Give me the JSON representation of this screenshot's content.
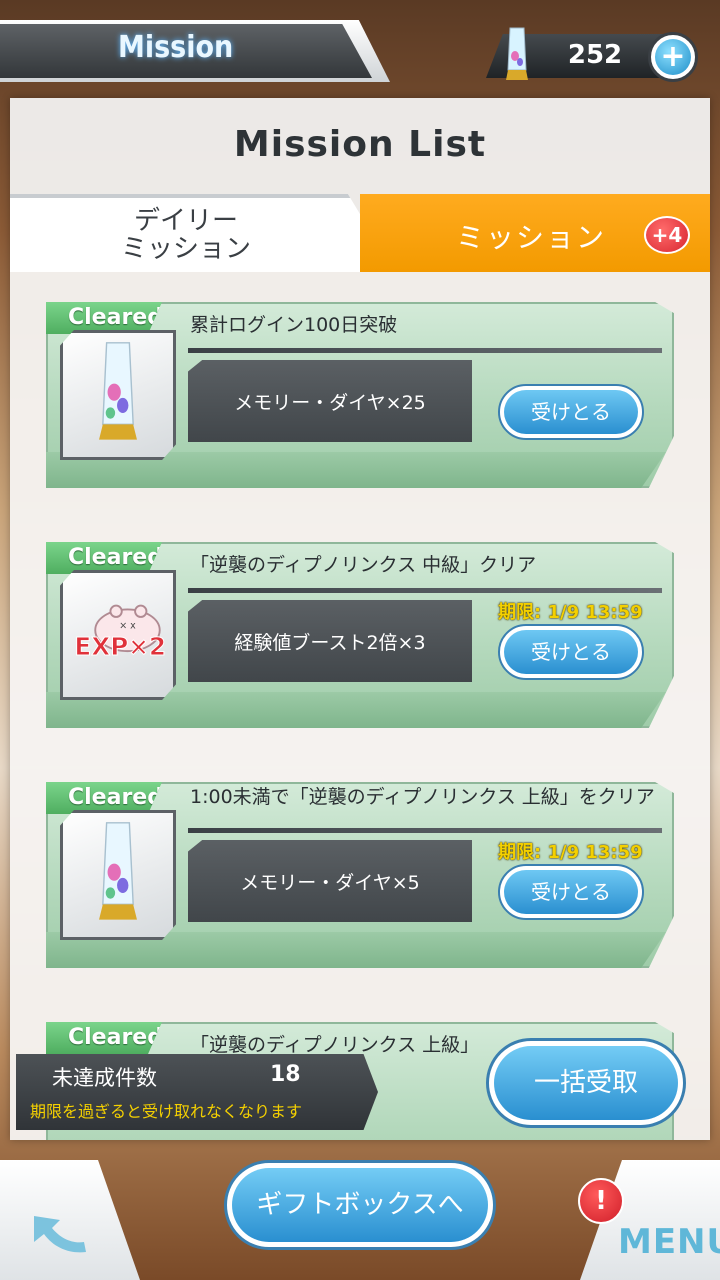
{
  "header": {
    "title": "Mission",
    "currency_value": "252",
    "currency_icon": "memory-diamond-icon",
    "add_icon": "plus-icon"
  },
  "panel": {
    "title": "Mission List",
    "tabs": [
      {
        "label": "デイリー\nミッション",
        "active": false
      },
      {
        "label": "ミッション",
        "active": true,
        "badge": "+4"
      }
    ]
  },
  "missions": [
    {
      "status": "Cleared",
      "title": "累計ログイン100日突破",
      "reward": "メモリー・ダイヤ×25",
      "reward_icon": "memory-diamond-icon",
      "deadline": "",
      "claim_label": "受けとる"
    },
    {
      "status": "Cleared",
      "title": "「逆襲のディプノリンクス 中級」クリア",
      "reward": "経験値ブースト2倍×3",
      "reward_icon": "exp-boost-cat-icon",
      "reward_icon_text": "EXP×2",
      "deadline": "期限: 1/9 13:59",
      "claim_label": "受けとる"
    },
    {
      "status": "Cleared",
      "title": "1:00未満で「逆襲のディプノリンクス 上級」をクリア",
      "reward": "メモリー・ダイヤ×5",
      "reward_icon": "memory-diamond-icon",
      "deadline": "期限: 1/9 13:59",
      "claim_label": "受けとる"
    },
    {
      "status": "Cleared",
      "title": "「逆襲のディプノリンクス 上級」",
      "partial": true
    }
  ],
  "summary": {
    "label": "未達成件数",
    "count": "18",
    "note": "期限を過ぎると受け取れなくなります"
  },
  "buttons": {
    "bulk_claim": "一括受取",
    "gift_box": "ギフトボックスへ",
    "menu": "MENU",
    "alert": "!"
  },
  "colors": {
    "accent_orange": "#f39a00",
    "card_green": "#b5d9bd",
    "button_blue": "#2a8fd0",
    "deadline_yellow": "#f4d000"
  }
}
